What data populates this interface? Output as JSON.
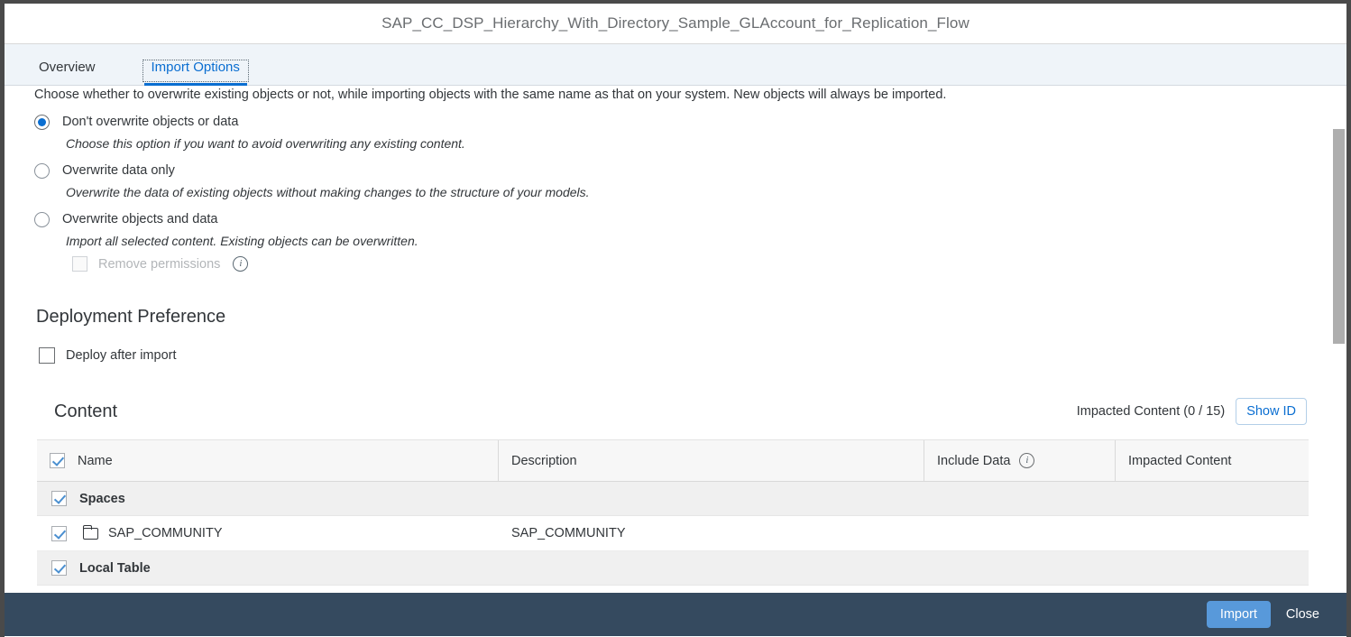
{
  "window": {
    "title": "SAP_CC_DSP_Hierarchy_With_Directory_Sample_GLAccount_for_Replication_Flow"
  },
  "tabs": [
    {
      "label": "Overview",
      "selected": false
    },
    {
      "label": "Import Options",
      "selected": true
    }
  ],
  "import_options": {
    "intro": "Choose whether to overwrite existing objects or not, while importing objects with the same name as that on your system. New objects will always be imported.",
    "options": [
      {
        "label": "Don't overwrite objects or data",
        "hint": "Choose this option if you want to avoid overwriting any existing content.",
        "selected": true
      },
      {
        "label": "Overwrite data only",
        "hint": "Overwrite the data of existing objects without making changes to the structure of your models.",
        "selected": false
      },
      {
        "label": "Overwrite objects and data",
        "hint": "Import all selected content. Existing objects can be overwritten.",
        "selected": false
      }
    ],
    "remove_permissions": {
      "label": "Remove permissions",
      "checked": false,
      "disabled": true,
      "info_icon": "info-icon",
      "info_glyph": "i"
    }
  },
  "deployment": {
    "heading": "Deployment Preference",
    "deploy_after_import": {
      "label": "Deploy after import",
      "checked": false
    }
  },
  "content": {
    "title": "Content",
    "impacted_summary": "Impacted Content (0 / 15)",
    "show_id_label": "Show ID",
    "columns": {
      "name": "Name",
      "description": "Description",
      "include_data": "Include Data",
      "include_data_info_glyph": "i",
      "impacted_content": "Impacted Content"
    },
    "header_checkbox_checked": true,
    "rows": [
      {
        "type": "group",
        "name": "Spaces",
        "description": "",
        "include_data": "",
        "impacted_content": "",
        "checked": true
      },
      {
        "type": "item",
        "name": "SAP_COMMUNITY",
        "description": "SAP_COMMUNITY",
        "include_data": "",
        "impacted_content": "",
        "checked": true,
        "icon": "folder-icon"
      },
      {
        "type": "group",
        "name": "Local Table",
        "description": "",
        "include_data": "",
        "impacted_content": "",
        "checked": true
      }
    ]
  },
  "footer": {
    "import_label": "Import",
    "close_label": "Close"
  },
  "colors": {
    "accent_blue": "#0a6ed1",
    "footer_bg": "#354a5f",
    "import_button": "#5899da",
    "tabbar_bg": "#eff4f9"
  }
}
